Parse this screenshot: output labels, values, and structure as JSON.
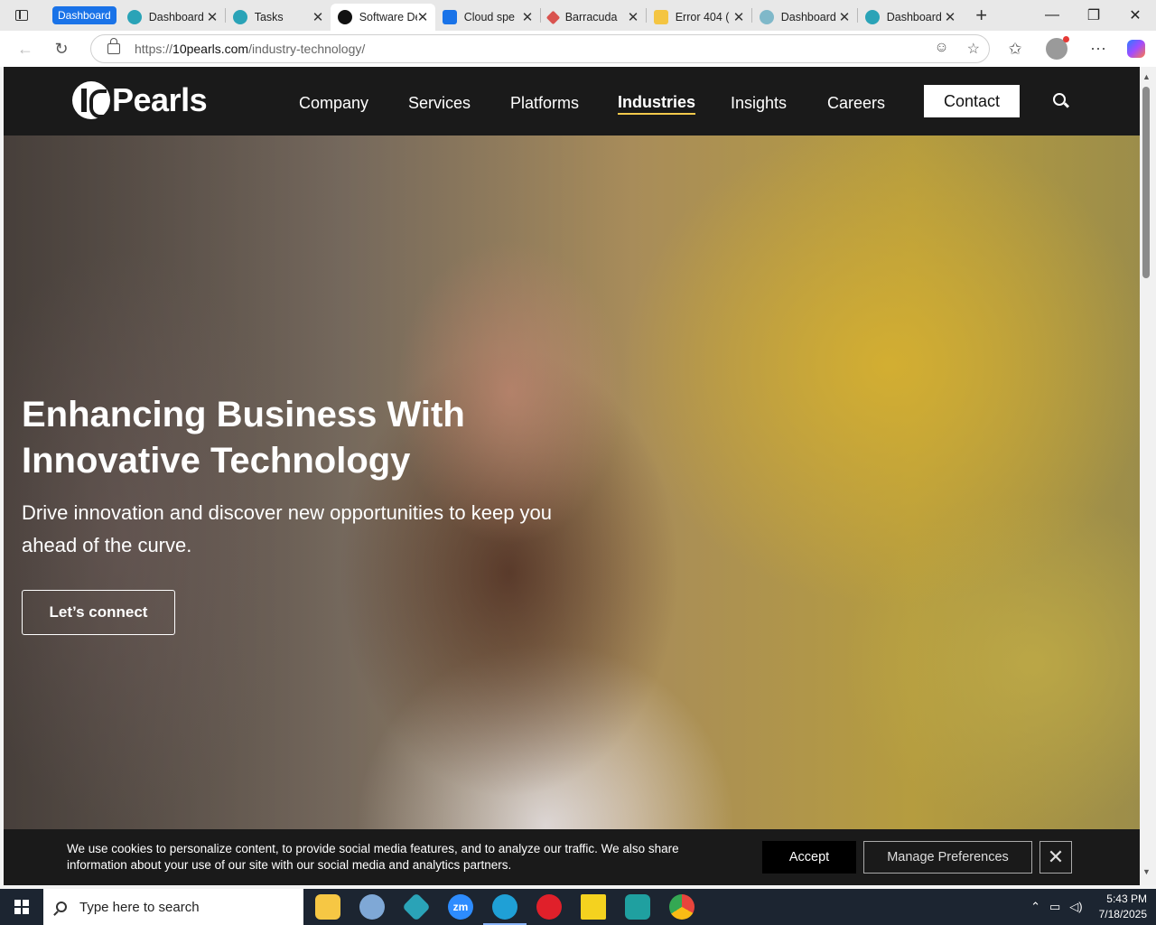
{
  "browser": {
    "tab_group": "Dashboard",
    "tabs": [
      {
        "label": "Dashboard",
        "favicon_color": "#2aa3b7",
        "active": false
      },
      {
        "label": "Tasks",
        "favicon_color": "#2aa3b7",
        "active": false
      },
      {
        "label": "Software De",
        "favicon_color": "#111111",
        "active": true
      },
      {
        "label": "Cloud spe",
        "favicon_color": "#1a73e8",
        "active": false
      },
      {
        "label": "Barracuda",
        "favicon_color": "#d9534f",
        "active": false
      },
      {
        "label": "Error 404 (",
        "favicon_color": "#f4c542",
        "active": false
      },
      {
        "label": "Dashboard",
        "favicon_color": "#7fb8c9",
        "active": false
      },
      {
        "label": "Dashboard",
        "favicon_color": "#2aa3b7",
        "active": false
      }
    ],
    "new_tab": "+",
    "window_controls": {
      "minimize": "—",
      "restore": "❐",
      "close": "✕"
    },
    "url_prefix": "https://",
    "url_domain": "10pearls.com",
    "url_path": "/industry-technology/"
  },
  "site": {
    "logo_text": "Pearls",
    "nav": [
      {
        "label": "Company",
        "active": false
      },
      {
        "label": "Services",
        "active": false
      },
      {
        "label": "Platforms",
        "active": false
      },
      {
        "label": "Industries",
        "active": true
      },
      {
        "label": "Insights",
        "active": false
      },
      {
        "label": "Careers",
        "active": false
      }
    ],
    "contact_label": "Contact",
    "accent_color": "#f2c94c"
  },
  "hero": {
    "title": "Enhancing Business With Innovative Technology",
    "subtitle": "Drive innovation and discover new opportunities to keep you ahead of the curve.",
    "cta_label": "Let’s connect"
  },
  "cookie": {
    "text": "We use cookies to personalize content, to provide social media features, and to analyze our traffic. We also share information about your use of our site with our social media and analytics partners.",
    "accept_label": "Accept",
    "manage_label": "Manage Preferences",
    "close_symbol": "✕"
  },
  "taskbar": {
    "search_placeholder": "Type here to search",
    "apps": [
      {
        "name": "file-explorer",
        "color": "#f6c744"
      },
      {
        "name": "paint-app",
        "color": "#7fa8d6"
      },
      {
        "name": "dev-app",
        "color": "#2aa3b7"
      },
      {
        "name": "zoom",
        "color": "#2d8cff",
        "label": "zm"
      },
      {
        "name": "edge",
        "color": "#1fa0d6"
      },
      {
        "name": "opera",
        "color": "#e0202a"
      },
      {
        "name": "sticky-notes",
        "color": "#f4d21f"
      },
      {
        "name": "s-app",
        "color": "#1fa0a0"
      },
      {
        "name": "chrome",
        "color": "#e8453c"
      }
    ],
    "time": "5:43 PM",
    "date": "7/18/2025"
  }
}
